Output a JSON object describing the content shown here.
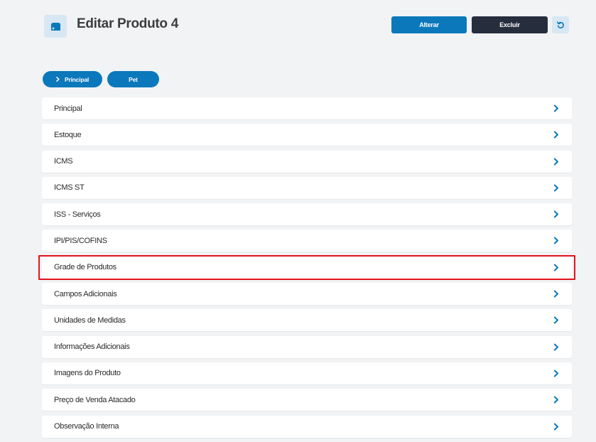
{
  "header": {
    "title": "Editar Produto 4",
    "icon": "product-box-icon",
    "buttons": {
      "alterar": "Alterar",
      "excluir": "Excluir",
      "back_icon": "undo-icon"
    }
  },
  "pills": [
    {
      "label": "Principal",
      "icon": "chevron-right-icon"
    },
    {
      "label": "Pet"
    }
  ],
  "sections": [
    {
      "label": "Principal"
    },
    {
      "label": "Estoque"
    },
    {
      "label": "ICMS"
    },
    {
      "label": "ICMS ST"
    },
    {
      "label": "ISS - Serviços"
    },
    {
      "label": "IPI/PIS/COFINS"
    },
    {
      "label": "Grade de Produtos",
      "highlighted": true
    },
    {
      "label": "Campos Adicionais"
    },
    {
      "label": "Unidades de Medidas"
    },
    {
      "label": "Informações Adicionais"
    },
    {
      "label": "Imagens do Produto"
    },
    {
      "label": "Preço de Venda Atacado"
    },
    {
      "label": "Observação Interna"
    }
  ],
  "colors": {
    "primary": "#0b78bb",
    "dark": "#262d3d",
    "highlight": "#e2141b",
    "background": "#f1f3f5"
  }
}
